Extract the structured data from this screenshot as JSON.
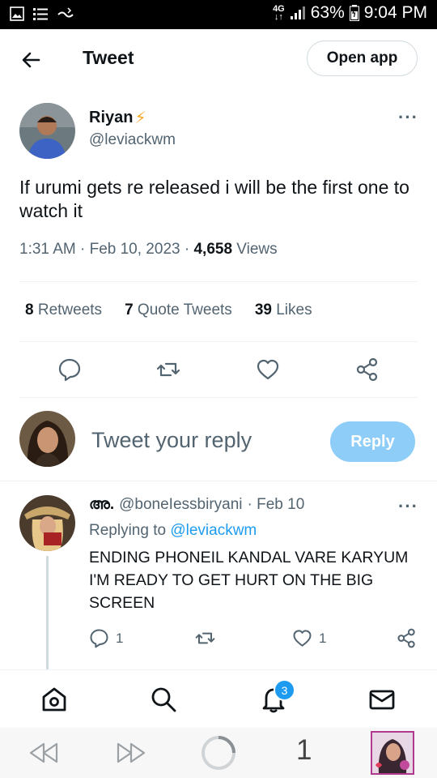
{
  "status_bar": {
    "network": "4G",
    "battery": "63%",
    "time": "9:04 PM"
  },
  "header": {
    "title": "Tweet",
    "open_app": "Open app"
  },
  "tweet": {
    "author_name": "Riyan",
    "author_emoji": "⚡",
    "author_handle": "@leviackwm",
    "text": "If urumi gets re released i will be the first one to watch it",
    "time": "1:31 AM · Feb 10, 2023 · ",
    "views_count": "4,658",
    "views_label": " Views",
    "retweets_count": "8",
    "retweets_label": " Retweets",
    "quotes_count": "7",
    "quotes_label": " Quote Tweets",
    "likes_count": "39",
    "likes_label": " Likes"
  },
  "composer": {
    "placeholder": "Tweet your reply",
    "reply_button": "Reply"
  },
  "reply": {
    "name": "അ.",
    "handle": "@boneIessbiryani",
    "date": "· Feb 10",
    "replying_label": "Replying to",
    "replying_handle": "@leviackwm",
    "text": "ENDING PHONEIL KANDAL VARE KARYUM I'M READY TO GET HURT ON THE BIG SCREEN",
    "reply_count": "1",
    "like_count": "1"
  },
  "bottom_nav": {
    "notification_badge": "3"
  },
  "system_bar": {
    "tab_count": "1"
  },
  "colors": {
    "accent": "#1d9bf0",
    "reply_button_disabled": "#8ecdf8",
    "text_secondary": "#536471"
  }
}
